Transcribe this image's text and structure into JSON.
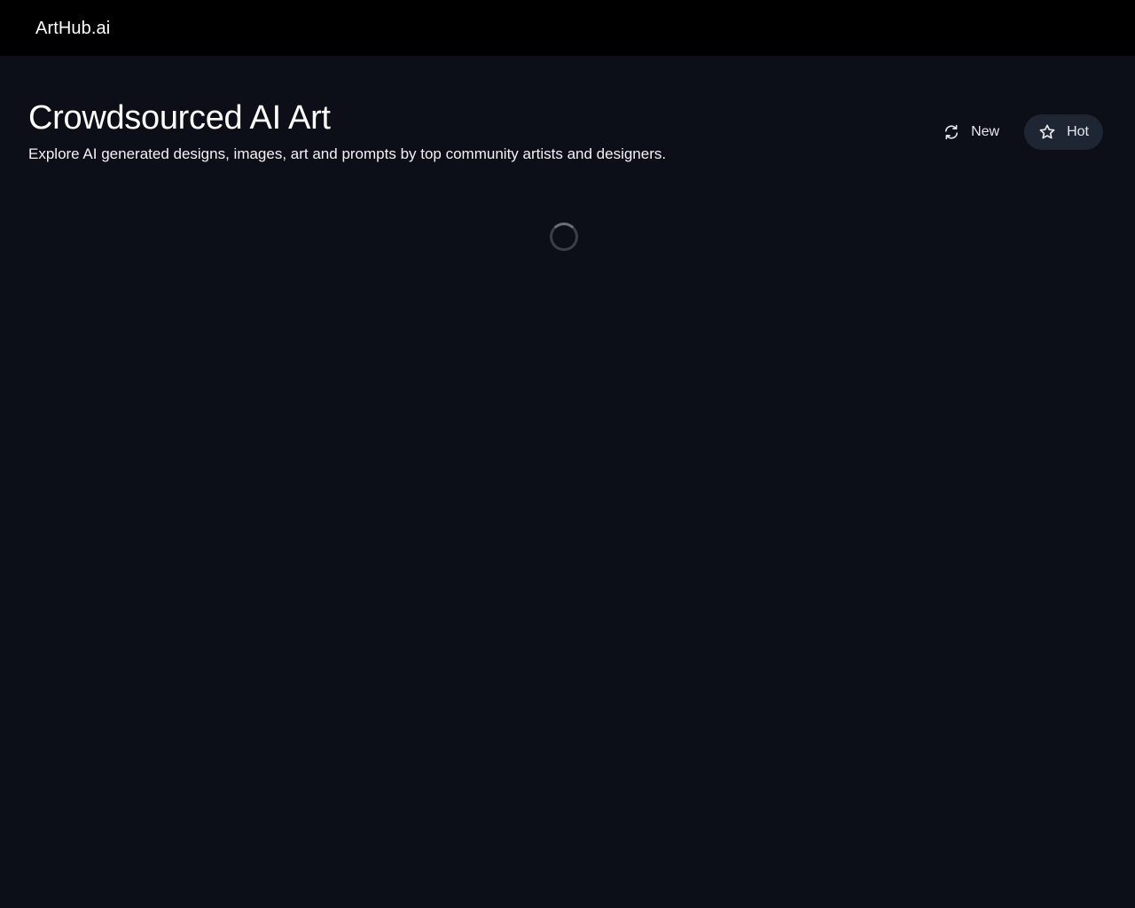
{
  "header": {
    "logo": "ArtHub.ai"
  },
  "hero": {
    "title": "Crowdsourced AI Art",
    "subtitle": "Explore AI generated designs, images, art and prompts by top community artists and designers."
  },
  "sort": {
    "options": [
      {
        "label": "New",
        "icon": "refresh-icon",
        "active": false
      },
      {
        "label": "Hot",
        "icon": "star-icon",
        "active": true
      }
    ]
  },
  "status": {
    "loading": true,
    "loading_icon": "loading-spinner-icon"
  },
  "colors": {
    "page_background": "#0c0f17",
    "topbar_background": "#000000",
    "active_pill": "#1f2633",
    "text": "#ffffff"
  }
}
